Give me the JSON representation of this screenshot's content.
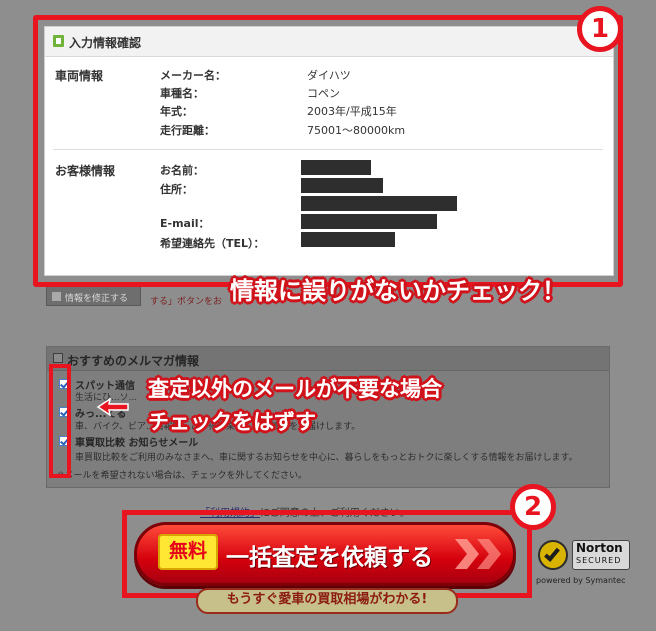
{
  "confirm": {
    "title": "入力情報確認",
    "vehicle_section": "車両情報",
    "vehicle": [
      {
        "label": "メーカー名：",
        "value": "ダイハツ"
      },
      {
        "label": "車種名：",
        "value": "コペン"
      },
      {
        "label": "年式：",
        "value": "2003年/平成15年"
      },
      {
        "label": "走行距離：",
        "value": "75001～80000km"
      }
    ],
    "customer_section": "お客様情報",
    "customer": [
      {
        "label": "お名前："
      },
      {
        "label": "住所："
      },
      {
        "label": "E-mail："
      },
      {
        "label": "希望連絡先（TEL）："
      }
    ]
  },
  "edit": {
    "button": "情報を修正する",
    "note": "する」ボタンをお"
  },
  "mail": {
    "title": "おすすめのメルマガ情報",
    "items": [
      {
        "name": "スパット通信",
        "desc": "生活にひ...ソ..."
      },
      {
        "name": "みっ...てる",
        "desc": "車、バイク、ビア...情報解...とお得に楽しくする情報をお届けします。"
      },
      {
        "name": "車買取比較 お知らせメール",
        "desc": "車買取比較をご利用のみなさまへ、車に関するお知らせを中心に、暮らしをもっとおトクに楽しくする情報をお届けします。"
      }
    ],
    "footnote": "※メールを希望されない場合は、チェックを外してください。"
  },
  "terms": {
    "link": "「利用規約」",
    "rest": "にご同意の上、ご利用ください。"
  },
  "submit": {
    "free": "無料",
    "label": "一括査定を依頼する",
    "banner": "もうすぐ愛車の買取相場がわかる!"
  },
  "norton": {
    "line1": "Norton",
    "line2": "SECURED",
    "powered": "powered by Symantec"
  },
  "annotations": {
    "badge1": "1",
    "badge2": "2",
    "callout1": "情報に誤りがないかチェック！",
    "callout2a": "査定以外のメールが不要な場合",
    "callout2b": "チェックをはずす"
  },
  "colors": {
    "highlight": "#e8141f",
    "button": "#d4000d",
    "free_badge": "#ffe733"
  }
}
